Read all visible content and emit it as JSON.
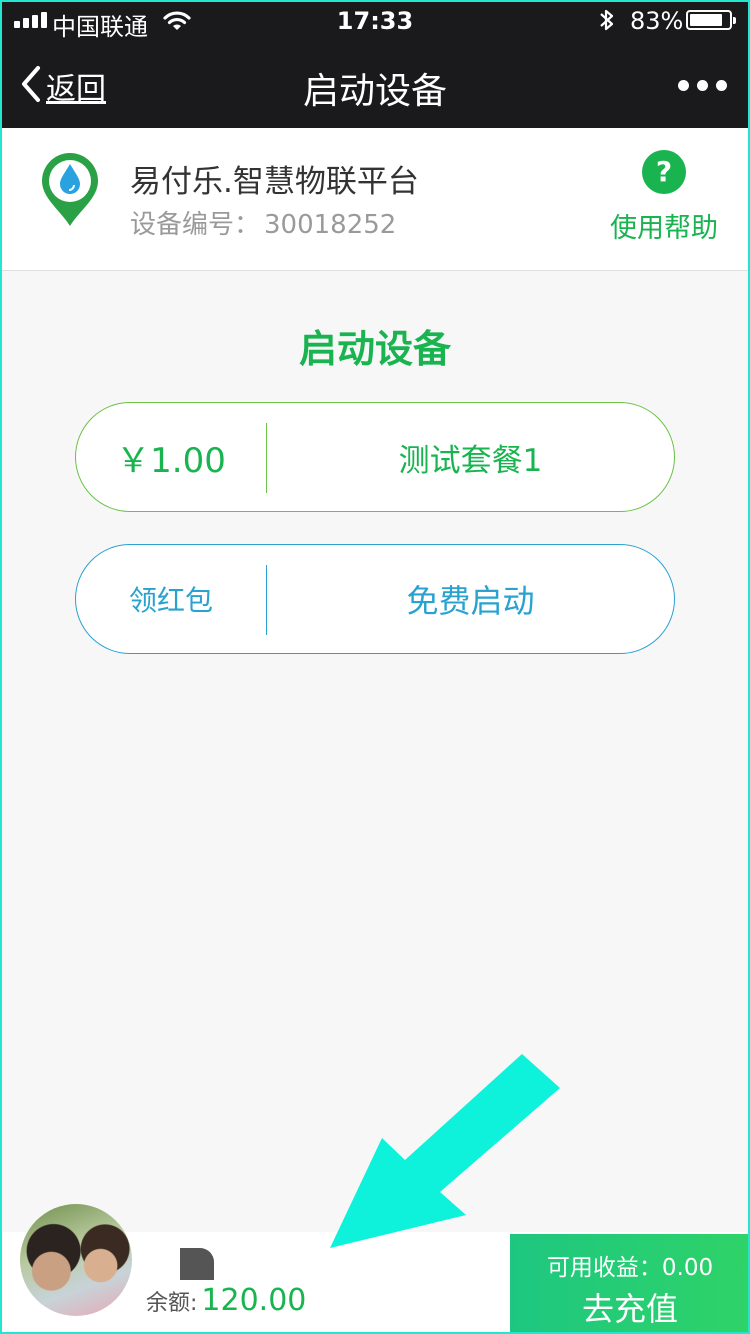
{
  "status_bar": {
    "carrier": "中国联通",
    "time": "17:33",
    "battery_percent": "83%",
    "battery_level": 0.83,
    "icons": [
      "signal-icon",
      "wifi-icon",
      "bluetooth-icon",
      "battery-icon"
    ]
  },
  "navbar": {
    "back_label": "返回",
    "title": "启动设备",
    "more_icon": "more-icon"
  },
  "device": {
    "app_name": "易付乐.智慧物联平台",
    "device_no_label": "设备编号：",
    "device_no": "30018252",
    "help_glyph": "?",
    "help_label": "使用帮助"
  },
  "main": {
    "title": "启动设备",
    "plans": [
      {
        "price": "￥1.00",
        "name": "测试套餐1",
        "color": "#19b450"
      },
      {
        "price": "领红包",
        "name": "免费启动",
        "color": "#2aa2d0"
      }
    ]
  },
  "bottom": {
    "balance_label": "余额:",
    "balance": "120.00",
    "earnings_label": "可用收益：0.00",
    "recharge_label": "去充值"
  },
  "colors": {
    "accent_green": "#19b450",
    "accent_blue": "#2aa2d0",
    "annotation_arrow": "#0ef2dc",
    "navbar_bg": "#1a1a1d"
  }
}
